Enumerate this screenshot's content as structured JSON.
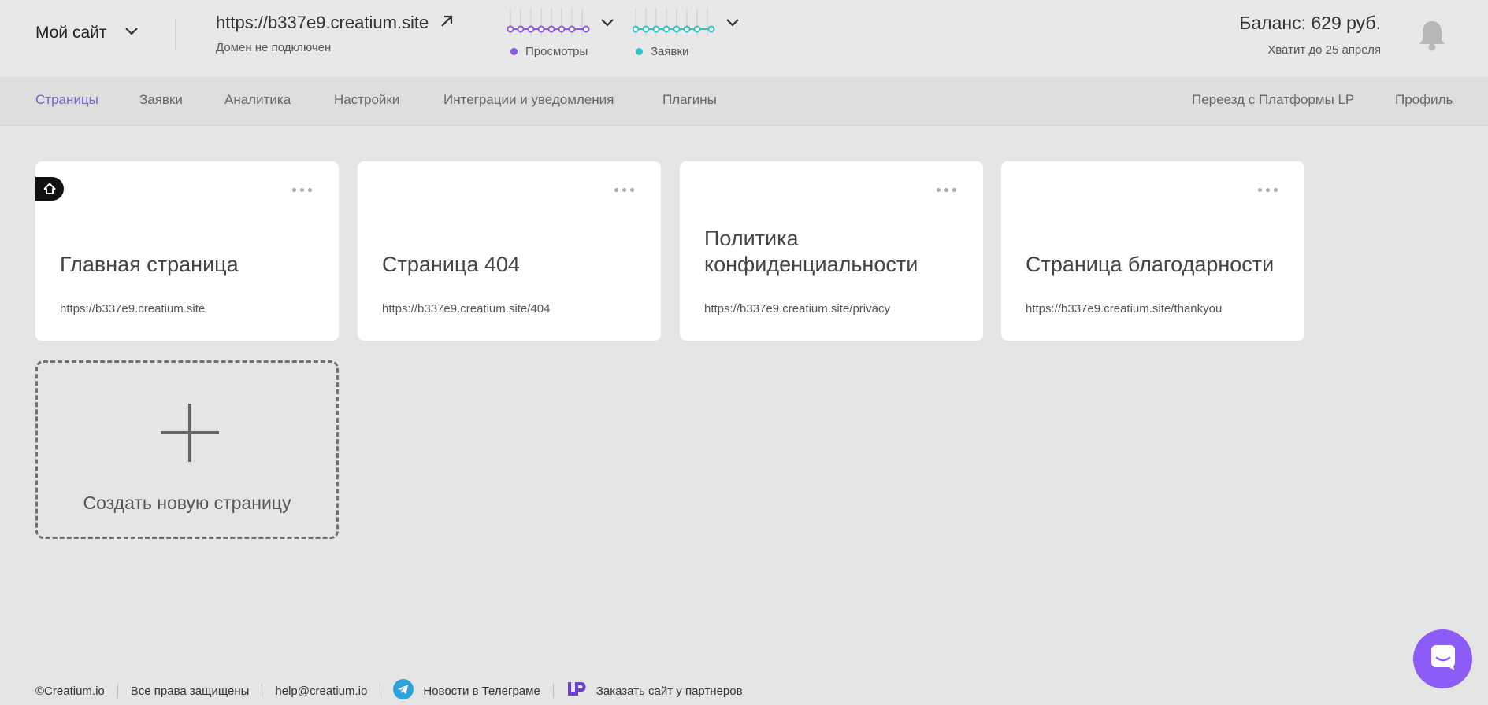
{
  "header": {
    "site_name": "Мой сайт",
    "domain_url": "https://b337e9.creatium.site",
    "domain_status": "Домен не подключен",
    "stats": [
      {
        "label": "Просмотры",
        "color": "#8b55e6"
      },
      {
        "label": "Заявки",
        "color": "#2ec4c4"
      }
    ],
    "balance": "Баланс: 629 руб.",
    "balance_until": "Хватит до 25 апреля"
  },
  "nav": {
    "left": [
      "Страницы",
      "Заявки",
      "Аналитика",
      "Настройки",
      "Интеграции и уведомления",
      "Плагины"
    ],
    "right": [
      "Переезд с Платформы LP",
      "Профиль"
    ],
    "active": "Страницы"
  },
  "pages": [
    {
      "title": "Главная страница",
      "url": "https://b337e9.creatium.site",
      "is_home": true
    },
    {
      "title": "Страница 404",
      "url": "https://b337e9.creatium.site/404",
      "is_home": false
    },
    {
      "title": "Политика конфиденциальности",
      "url": "https://b337e9.creatium.site/privacy",
      "is_home": false
    },
    {
      "title": "Страница благодарности",
      "url": "https://b337e9.creatium.site/thankyou",
      "is_home": false
    }
  ],
  "new_page_label": "Создать новую страницу",
  "footer": {
    "copyright": "©Creatium.io",
    "rights": "Все права защищены",
    "email": "help@creatium.io",
    "telegram": "Новости в Телеграме",
    "partners": "Заказать сайт у партнеров"
  },
  "icons": {
    "dropdown": "chevron-down-icon",
    "external": "arrow-up-right-icon",
    "bell": "bell-icon",
    "home": "home-icon",
    "more": "ellipsis-icon",
    "plus": "plus-icon",
    "telegram": "telegram-icon",
    "partners": "lp-logo-icon",
    "chat": "chat-icon"
  }
}
